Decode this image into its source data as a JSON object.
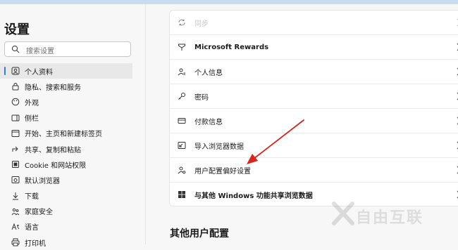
{
  "sidebar": {
    "title": "设置",
    "search_placeholder": "搜索设置",
    "items": [
      {
        "label": "个人资料",
        "icon": "profile-icon",
        "active": true
      },
      {
        "label": "隐私、搜索和服务",
        "icon": "lock-icon"
      },
      {
        "label": "外观",
        "icon": "appearance-icon"
      },
      {
        "label": "侧栏",
        "icon": "sidebar-icon"
      },
      {
        "label": "开始、主页和新建标签页",
        "icon": "home-icon"
      },
      {
        "label": "共享、复制和粘贴",
        "icon": "share-icon"
      },
      {
        "label": "Cookie 和网站权限",
        "icon": "cookie-icon"
      },
      {
        "label": "默认浏览器",
        "icon": "browser-icon"
      },
      {
        "label": "下载",
        "icon": "download-icon"
      },
      {
        "label": "家庭安全",
        "icon": "family-icon"
      },
      {
        "label": "语言",
        "icon": "language-icon"
      },
      {
        "label": "打印机",
        "icon": "printer-icon"
      }
    ]
  },
  "main": {
    "rows": [
      {
        "label": "同步",
        "icon": "sync-icon"
      },
      {
        "label": "Microsoft Rewards",
        "icon": "rewards-icon"
      },
      {
        "label": "个人信息",
        "icon": "personal-info-icon"
      },
      {
        "label": "密码",
        "icon": "key-icon"
      },
      {
        "label": "付款信息",
        "icon": "card-icon"
      },
      {
        "label": "导入浏览器数据",
        "icon": "import-icon"
      },
      {
        "label": "用户配置偏好设置",
        "icon": "profile-prefs-icon"
      },
      {
        "label": "与其他 Windows 功能共享浏览数据",
        "icon": "windows-icon"
      }
    ],
    "section_title": "其他用户配置"
  },
  "annotation": {
    "color": "#d9241b",
    "points_to": "用户配置偏好设置"
  },
  "watermark": {
    "text": "自由互联"
  }
}
